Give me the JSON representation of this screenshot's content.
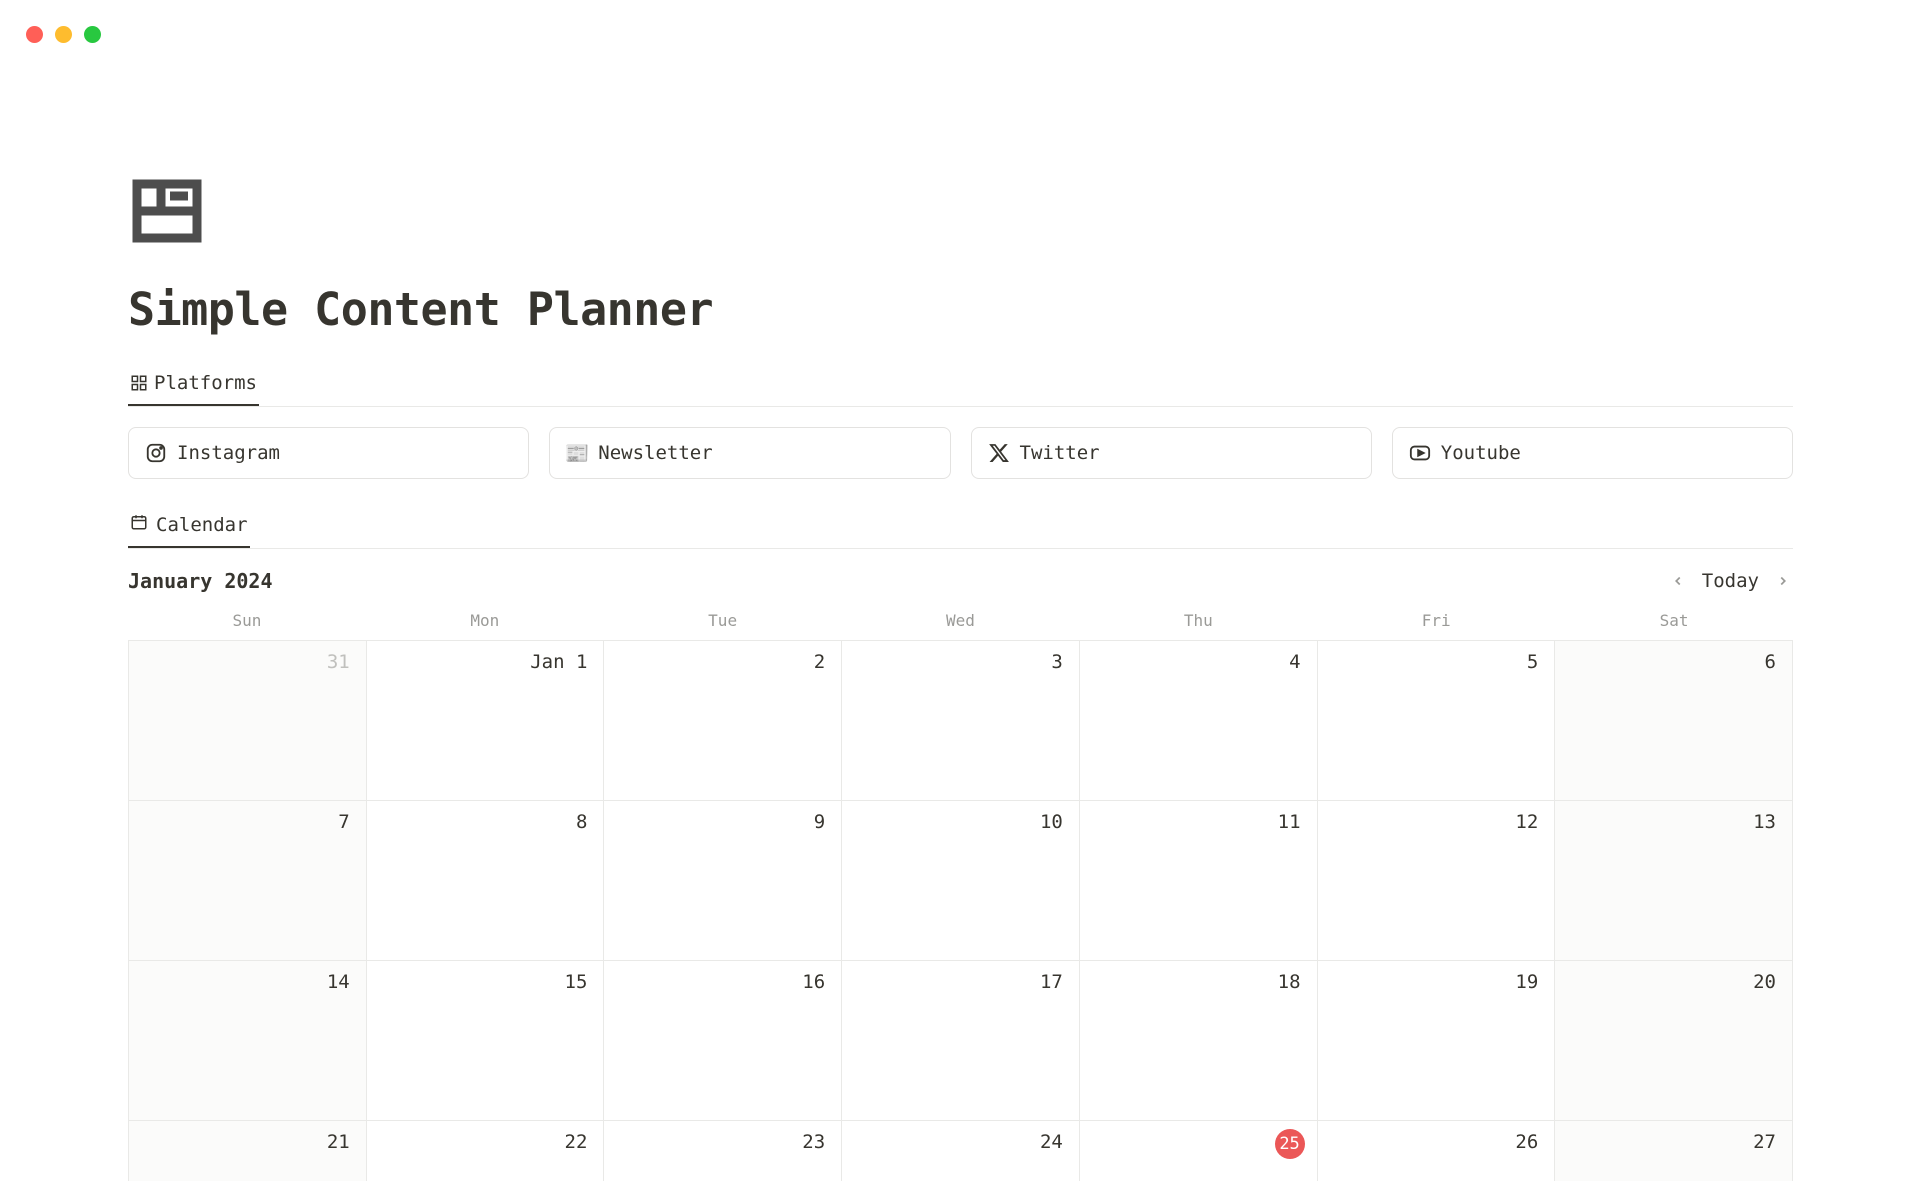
{
  "page": {
    "title": "Simple Content Planner"
  },
  "tabs": {
    "platforms": "Platforms"
  },
  "platforms": [
    {
      "name": "Instagram",
      "icon": "instagram"
    },
    {
      "name": "Newsletter",
      "icon": "newspaper-emoji"
    },
    {
      "name": "Twitter",
      "icon": "x"
    },
    {
      "name": "Youtube",
      "icon": "youtube"
    }
  ],
  "calendar": {
    "tab_label": "Calendar",
    "month_label": "January 2024",
    "today_label": "Today",
    "weekdays": [
      "Sun",
      "Mon",
      "Tue",
      "Wed",
      "Thu",
      "Fri",
      "Sat"
    ],
    "today_date": 25,
    "weeks": [
      [
        {
          "label": "31",
          "outside": true
        },
        {
          "label": "Jan 1"
        },
        {
          "label": "2"
        },
        {
          "label": "3"
        },
        {
          "label": "4"
        },
        {
          "label": "5"
        },
        {
          "label": "6"
        }
      ],
      [
        {
          "label": "7"
        },
        {
          "label": "8"
        },
        {
          "label": "9"
        },
        {
          "label": "10"
        },
        {
          "label": "11"
        },
        {
          "label": "12"
        },
        {
          "label": "13"
        }
      ],
      [
        {
          "label": "14"
        },
        {
          "label": "15"
        },
        {
          "label": "16"
        },
        {
          "label": "17"
        },
        {
          "label": "18"
        },
        {
          "label": "19"
        },
        {
          "label": "20"
        }
      ],
      [
        {
          "label": "21"
        },
        {
          "label": "22"
        },
        {
          "label": "23"
        },
        {
          "label": "24"
        },
        {
          "label": "25",
          "today": true
        },
        {
          "label": "26"
        },
        {
          "label": "27"
        }
      ]
    ]
  }
}
